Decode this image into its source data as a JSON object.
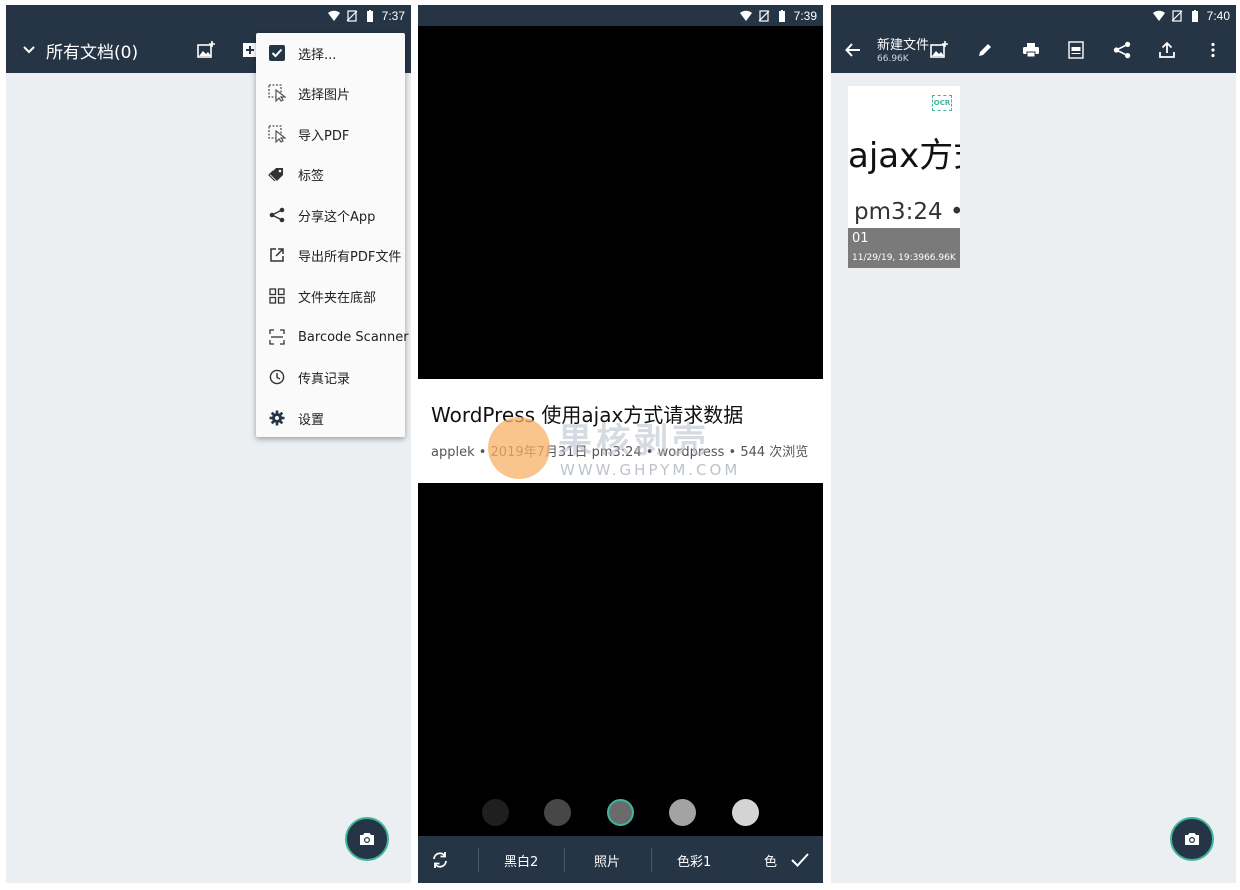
{
  "colors": {
    "appbar": "#263545",
    "background": "#eceff1",
    "accent": "#3fb59f",
    "menu_bg": "#fafafa"
  },
  "phone1": {
    "status": {
      "time": "7:37"
    },
    "title": "所有文档(0)",
    "icons": [
      "chevron-down-icon",
      "add-image-icon",
      "add-icon"
    ],
    "menu": [
      {
        "label": "选择...",
        "icon": "checkbox-icon"
      },
      {
        "label": "选择图片",
        "icon": "select-image-icon"
      },
      {
        "label": "导入PDF",
        "icon": "import-pdf-icon"
      },
      {
        "label": "标签",
        "icon": "tag-icon"
      },
      {
        "label": "分享这个App",
        "icon": "share-icon"
      },
      {
        "label": "导出所有PDF文件",
        "icon": "export-icon"
      },
      {
        "label": "文件夹在底部",
        "icon": "grid-icon"
      },
      {
        "label": "Barcode Scanner",
        "icon": "barcode-icon"
      },
      {
        "label": "传真记录",
        "icon": "clock-icon"
      },
      {
        "label": "设置",
        "icon": "gear-icon"
      }
    ]
  },
  "phone2": {
    "status": {
      "time": "7:39"
    },
    "article": {
      "title": "WordPress 使用ajax方式请求数据",
      "meta": "applek • 2019年7月31日 pm3:24 • wordpress • 544 次浏览"
    },
    "watermark": {
      "text": "果核剥壳",
      "url": "WWW.GHPYM.COM"
    },
    "swatches": [
      "#1f1f1f",
      "#474747",
      "#6b6b6b",
      "#a3a3a3",
      "#d4d4d4"
    ],
    "filters": [
      "黑白2",
      "照片",
      "色彩1",
      "色"
    ]
  },
  "phone3": {
    "status": {
      "time": "7:40"
    },
    "title": "新建文件",
    "size": "66.96K",
    "thumb": {
      "ocr": "OCR",
      "preview_big": "ajax方式",
      "preview_mid": "pm3:24 •",
      "name": "01",
      "meta": "11/29/19, 19:3966.96K"
    }
  }
}
